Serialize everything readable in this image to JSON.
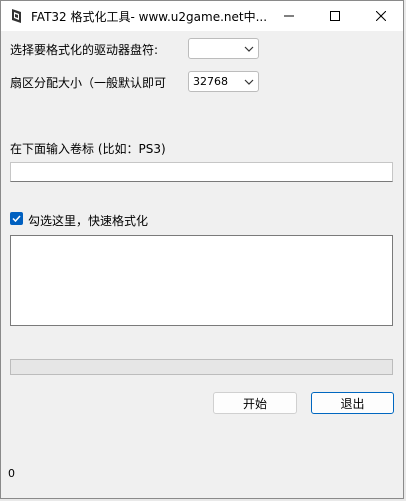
{
  "window": {
    "title": "FAT32 格式化工具- www.u2game.net中..."
  },
  "form": {
    "drive_label": "选择要格式化的驱动器盘符:",
    "drive_value": "",
    "cluster_label": "扇区分配大小（一般默认即可",
    "cluster_value": "32768",
    "volume_label_caption": "在下面输入卷标 (比如：PS3)",
    "volume_label_value": "",
    "quick_format_label": "勾选这里，快速格式化",
    "quick_format_checked": true,
    "log_text": "",
    "progress_percent": 0,
    "start_button": "开始",
    "exit_button": "退出",
    "status_text": "0"
  },
  "colors": {
    "accent": "#0060c0",
    "background": "#f0f0f0"
  }
}
